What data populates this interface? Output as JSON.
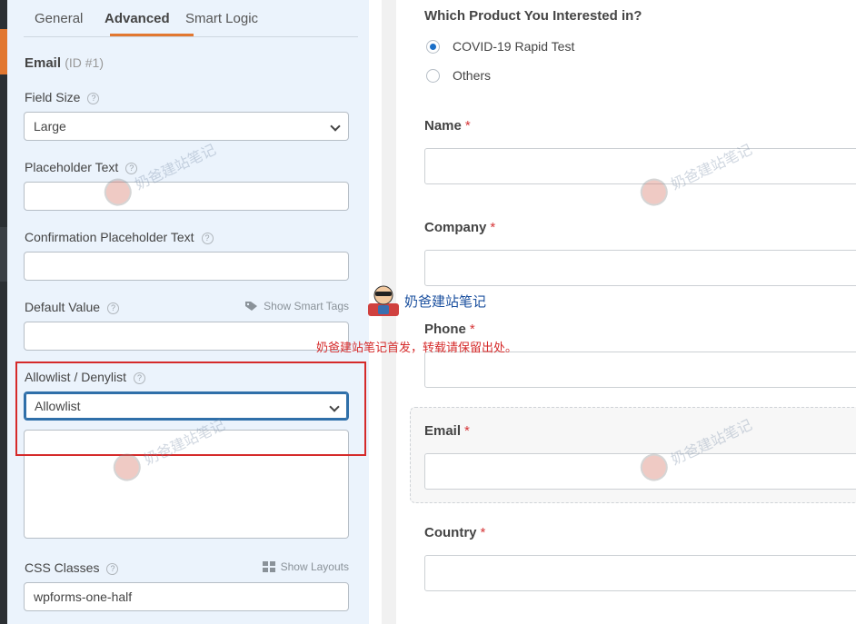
{
  "panel": {
    "tabs": [
      "General",
      "Advanced",
      "Smart Logic"
    ],
    "field_name": "Email",
    "field_id": "(ID #1)",
    "field_size_label": "Field Size",
    "field_size_value": "Large",
    "placeholder_label": "Placeholder Text",
    "placeholder_value": "",
    "confirm_placeholder_label": "Confirmation Placeholder Text",
    "confirm_placeholder_value": "",
    "default_value_label": "Default Value",
    "show_smart_tags": "Show Smart Tags",
    "default_value": "",
    "allowlist_label": "Allowlist / Denylist",
    "allowlist_value": "Allowlist",
    "allowlist_text": "",
    "css_classes_label": "CSS Classes",
    "show_layouts": "Show Layouts",
    "css_classes_value": "wpforms-one-half"
  },
  "preview": {
    "question": "Which Product You Interested in?",
    "options": [
      "COVID-19 Rapid Test",
      "Others"
    ],
    "fields": [
      {
        "label": "Name",
        "required": "*"
      },
      {
        "label": "Company",
        "required": "*"
      },
      {
        "label": "Phone",
        "required": "*"
      },
      {
        "label": "Email",
        "required": "*"
      },
      {
        "label": "Country",
        "required": "*"
      }
    ]
  },
  "watermark": {
    "text": "奶爸建站笔记",
    "note": "奶爸建站笔记首发，转载请保留出处。"
  },
  "colors": {
    "accent": "#e27730",
    "focus_border": "#2f6fa9",
    "highlight_box": "#d52a2a",
    "required": "#d63638"
  }
}
